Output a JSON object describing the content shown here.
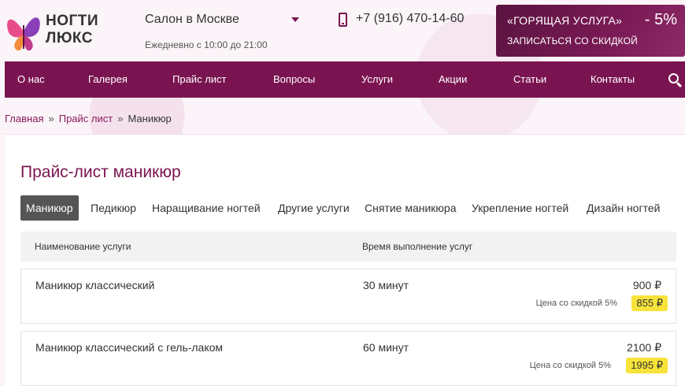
{
  "header": {
    "logo_line1": "НОГТИ",
    "logo_line2": "ЛЮКС",
    "city": "Салон в Москве",
    "hours": "Ежедневно с 10:00 до 21:00",
    "phone": "+7 (916) 470-14-60",
    "promo_title": "«ГОРЯЩАЯ УСЛУГА»",
    "promo_pct": "- 5%",
    "promo_sub": "ЗАПИСАТЬСЯ СО СКИДКОЙ"
  },
  "nav": {
    "items": [
      "О нас",
      "Галерея",
      "Прайс лист",
      "Вопросы",
      "Услуги",
      "Акции",
      "Статьи",
      "Контакты"
    ]
  },
  "breadcrumb": {
    "home": "Главная",
    "price": "Прайс лист",
    "current": "Маникюр",
    "sep": "»"
  },
  "main": {
    "title": "Прайс-лист маникюр",
    "tabs": [
      "Маникюр",
      "Педикюр",
      "Наращивание ногтей",
      "Другие услуги",
      "Снятие маникюра",
      "Укрепление ногтей",
      "Дизайн ногтей"
    ],
    "active_tab": "Маникюр",
    "table": {
      "col_name": "Наименование услуги",
      "col_time": "Время выполнение услуг",
      "rows": [
        {
          "name": "Маникюр классический",
          "time": "30 минут",
          "price": "900 ₽",
          "discount_label": "Цена со скидкой 5%",
          "discount_price": "855 ₽"
        },
        {
          "name": "Маникюр классический с гель-лаком",
          "time": "60 минут",
          "price": "2100 ₽",
          "discount_label": "Цена со скидкой 5%",
          "discount_price": "1995 ₽"
        }
      ]
    }
  },
  "colors": {
    "brand": "#7a1450",
    "highlight": "#f7e33a",
    "active_tab": "#555555"
  }
}
